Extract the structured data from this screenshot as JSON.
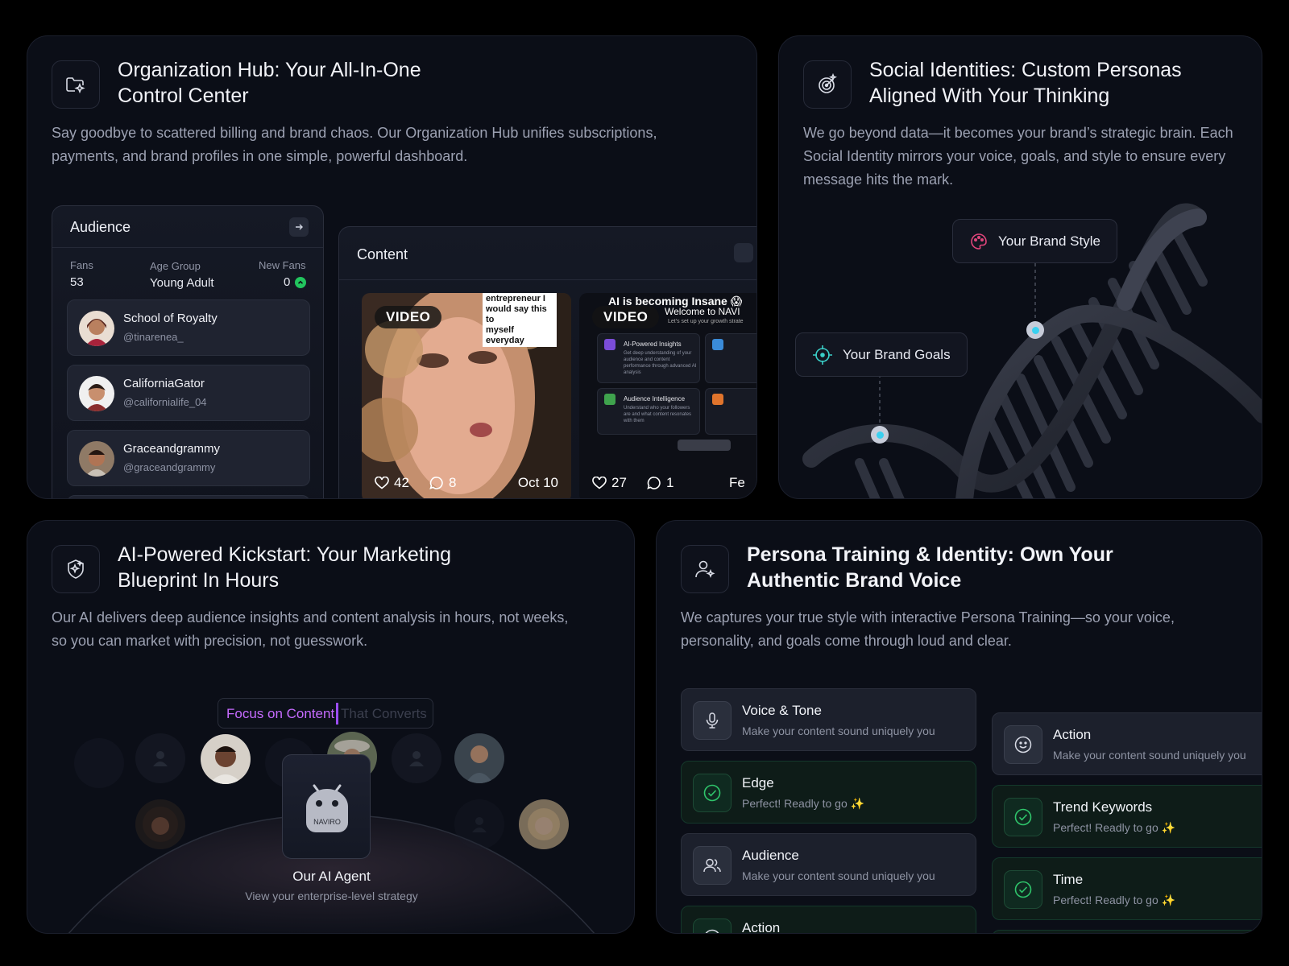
{
  "org": {
    "title_l1": "Organization Hub: Your All-In-One",
    "title_l2": "Control Center",
    "desc_l1": "Say goodbye to scattered billing and brand chaos. Our  Organization Hub unifies subscriptions,",
    "desc_l2": "payments, and brand profiles in one simple, powerful dashboard.",
    "audience": {
      "title": "Audience",
      "stats": [
        {
          "label": "Fans",
          "value": "53"
        },
        {
          "label": "Age Group",
          "value": "Young Adult"
        },
        {
          "label": "New Fans",
          "value": "0"
        }
      ],
      "items": [
        {
          "name": "School of Royalty",
          "handle": "@tinarenea_"
        },
        {
          "name": "CaliforniaGator",
          "handle": "@californialife_04"
        },
        {
          "name": "Graceandgrammy",
          "handle": "@graceandgrammy"
        }
      ]
    },
    "content": {
      "title": "Content",
      "videos": [
        {
          "badge": "VIDEO",
          "likes": "42",
          "comments": "8",
          "date": "Oct 10",
          "caption_l1": "entrepreneur I",
          "caption_l2": "would say this to",
          "caption_l3": "myself everyday"
        },
        {
          "badge": "VIDEO",
          "likes": "27",
          "comments": "1",
          "date": "Fe",
          "overlay_l1": "AI is becoming Insane 😱",
          "overlay_l2": "Welcome to NAVI",
          "overlay_l3": "Let's set up your growth strate",
          "feat1_title": "AI-Powered Insights",
          "feat1_desc": "Get deep understanding of your audience and content performance through advanced AI analysis",
          "feat2_title": "Audience Intelligence",
          "feat2_desc": "Understand who your followers are and what content resonates with them"
        }
      ]
    }
  },
  "social": {
    "title_l1": "Social Identities: Custom Personas",
    "title_l2": "Aligned With Your Thinking",
    "desc_l1": "We go beyond data—it becomes your brand’s strategic brain. Each",
    "desc_l2": "Social Identity mirrors your voice, goals, and style to ensure every",
    "desc_l3": "message hits the mark.",
    "chip_style": "Your Brand Style",
    "chip_goals": "Your Brand Goals"
  },
  "ai": {
    "title_l1": "AI-Powered Kickstart: Your Marketing",
    "title_l2": "Blueprint In Hours",
    "desc_l1": "Our AI delivers deep audience insights and content analysis in hours, not weeks,",
    "desc_l2": "so you can market with precision, not guesswork.",
    "typed": "Focus on Content",
    "typed_rest": "That Converts",
    "agent_logo": "NAVIRO",
    "agent_title": "Our AI Agent",
    "agent_sub": "View your enterprise-level strategy"
  },
  "persona": {
    "title_l1": "Persona Training & Identity: Own Your",
    "title_l2": "Authentic Brand Voice",
    "desc_l1": "We captures your true style with interactive Persona Training—so your voice,",
    "desc_l2": "personality, and goals come through loud and clear.",
    "left_items": [
      {
        "title": "Voice & Tone",
        "sub": "Make your content sound uniquely you"
      },
      {
        "title": "Edge",
        "sub": "Perfect! Readly to go ✨"
      },
      {
        "title": "Audience",
        "sub": "Make your content sound uniquely you"
      },
      {
        "title": "Action",
        "sub": ""
      }
    ],
    "right_items": [
      {
        "title": "Action",
        "sub": "Make your content sound uniquely you"
      },
      {
        "title": "Trend Keywords",
        "sub": "Perfect! Readly to go ✨"
      },
      {
        "title": "Time",
        "sub": "Perfect! Readly to go ✨"
      }
    ]
  },
  "colors": {
    "accent_cyan": "#3ad0f0",
    "success": "#22c55e",
    "typing": "#c66bff"
  }
}
